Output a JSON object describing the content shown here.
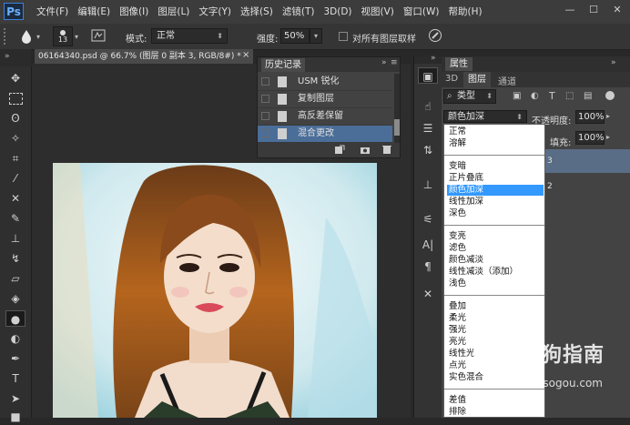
{
  "app": {
    "logo": "Ps"
  },
  "menu": [
    "文件(F)",
    "编辑(E)",
    "图像(I)",
    "图层(L)",
    "文字(Y)",
    "选择(S)",
    "滤镜(T)",
    "3D(D)",
    "视图(V)",
    "窗口(W)",
    "帮助(H)"
  ],
  "window_controls": {
    "minimize": "—",
    "maximize": "☐",
    "close": "✕"
  },
  "options": {
    "brush_size": "13",
    "mode_label": "模式:",
    "mode_value": "正常",
    "strength_label": "强度:",
    "strength_value": "50%",
    "sample_all_label": "对所有图层取样"
  },
  "document": {
    "tab_title": "06164340.psd @ 66.7% (图层 0 副本 3, RGB/8#) *",
    "tab_close": "×"
  },
  "history": {
    "title": "历史记录",
    "items": [
      "USM 锐化",
      "复制图层",
      "高反差保留",
      "混合更改"
    ],
    "selected_index": 3
  },
  "layers_panel": {
    "tabs": [
      "3D",
      "图层",
      "通道"
    ],
    "header_label": "属性",
    "kind_label": "类型",
    "blend_mode": "颜色加深",
    "opacity_label": "不透明度:",
    "opacity_value": "100%",
    "fill_label": "填充:",
    "fill_value": "100%",
    "layer_rows": [
      "3",
      "2"
    ]
  },
  "blend_modes": {
    "groups": [
      [
        "正常",
        "溶解"
      ],
      [
        "变暗",
        "正片叠底",
        "颜色加深",
        "线性加深",
        "深色"
      ],
      [
        "变亮",
        "滤色",
        "颜色减淡",
        "线性减淡（添加）",
        "浅色"
      ],
      [
        "叠加",
        "柔光",
        "强光",
        "亮光",
        "线性光",
        "点光",
        "实色混合"
      ],
      [
        "差值",
        "排除"
      ]
    ],
    "selected": "颜色加深"
  },
  "watermark": {
    "text": "搜狗指南",
    "url": "zhinan.sogou.com"
  },
  "colors": {
    "selection_blue": "#3399ff",
    "history_selected": "#4b6e99",
    "ps_blue": "#3f7fd6"
  }
}
